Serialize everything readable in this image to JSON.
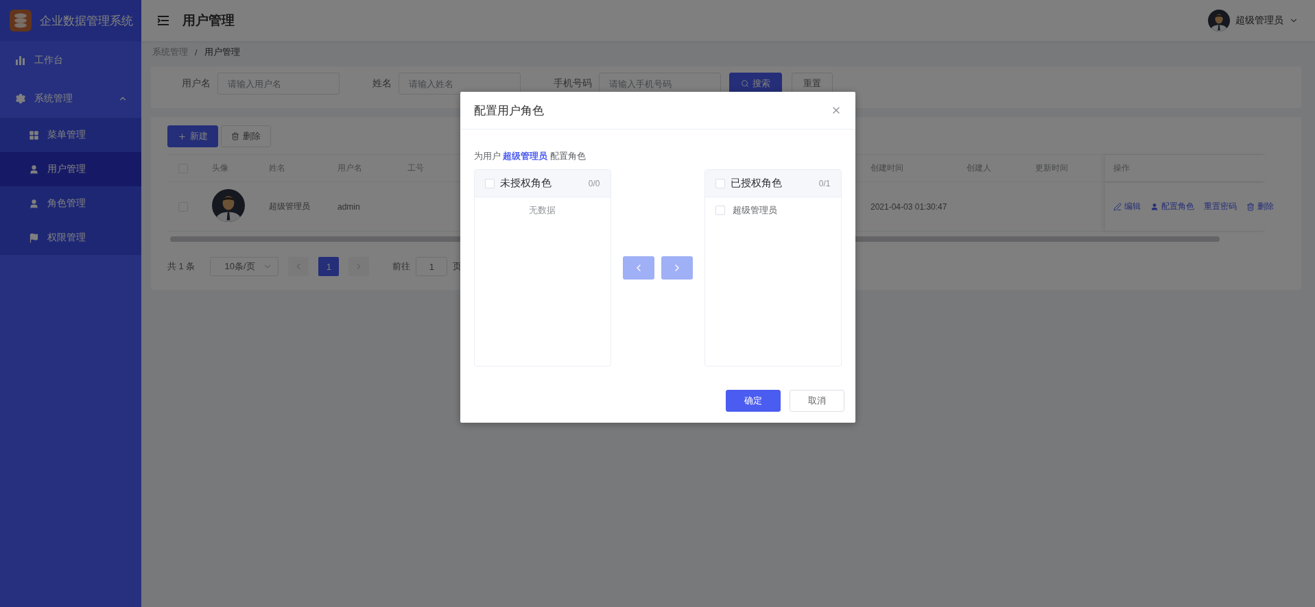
{
  "sidebar": {
    "title": "企业数据管理系统",
    "items": [
      {
        "label": "工作台",
        "selected": false
      },
      {
        "label": "系统管理",
        "selected": false,
        "expanded": true,
        "children": [
          {
            "label": "菜单管理",
            "selected": false
          },
          {
            "label": "用户管理",
            "selected": true
          },
          {
            "label": "角色管理",
            "selected": false
          },
          {
            "label": "权限管理",
            "selected": false
          }
        ]
      }
    ]
  },
  "header": {
    "title": "用户管理",
    "user": "超级管理员"
  },
  "breadcrumb": {
    "separator": "/",
    "items": [
      "系统管理",
      "用户管理"
    ]
  },
  "search": {
    "fields": [
      {
        "label": "用户名",
        "placeholder": "请输入用户名"
      },
      {
        "label": "姓名",
        "placeholder": "请输入姓名"
      },
      {
        "label": "手机号码",
        "placeholder": "请输入手机号码"
      }
    ],
    "buttons": [
      {
        "label": "搜索",
        "kind": "primary"
      },
      {
        "label": "重置",
        "kind": "default"
      }
    ]
  },
  "toolbar": [
    {
      "label": "新建",
      "kind": "primary"
    },
    {
      "label": "删除",
      "kind": "default"
    }
  ],
  "table": {
    "header_checked": false,
    "columns": [
      "头像",
      "姓名",
      "用户名",
      "工号",
      "创建时间",
      "创建人",
      "更新时间",
      "操作"
    ],
    "rows": [
      {
        "checked": false,
        "name": "超级管理员",
        "username": "admin",
        "created_at": "2021-04-03 01:30:47",
        "actions": [
          "编辑",
          "配置角色",
          "重置密码",
          "删除"
        ]
      }
    ]
  },
  "pagination": {
    "total": "共 1 条",
    "page_size": "10条/页",
    "pages": [
      {
        "label": "1",
        "selected": true
      }
    ],
    "goto_label": "前往",
    "goto_value": "1",
    "goto_suffix": "页"
  },
  "dialog": {
    "title": "配置用户角色",
    "intro": "为用户 **超级管理员** 配置角色",
    "panels": [
      {
        "title": "未授权角色",
        "count": "0/0",
        "checked": false,
        "empty_text": "无数据"
      },
      {
        "title": "已授权角色",
        "count": "0/1",
        "checked": false,
        "items": [
          {
            "label": "超级管理员",
            "checked": false
          }
        ]
      }
    ],
    "transfer_disabled": true,
    "buttons": [
      {
        "label": "确定",
        "kind": "primary"
      },
      {
        "label": "取消",
        "kind": "default"
      }
    ]
  }
}
